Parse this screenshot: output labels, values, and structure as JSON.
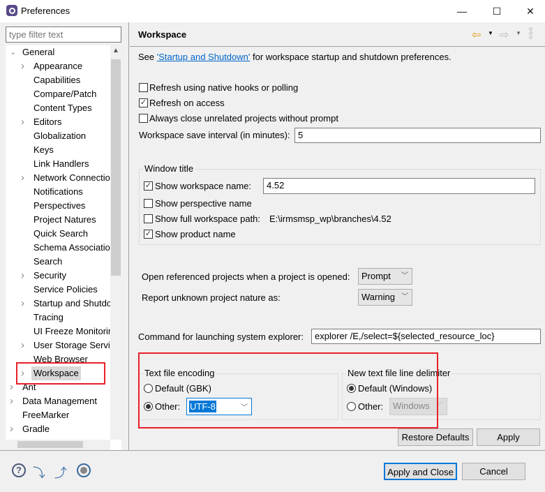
{
  "window": {
    "title": "Preferences",
    "minimize": "—",
    "maximize": "☐",
    "close": "✕"
  },
  "filter": {
    "placeholder": "type filter text"
  },
  "tree": {
    "items": [
      {
        "label": "General",
        "level": 0,
        "arrow": "down"
      },
      {
        "label": "Appearance",
        "level": 1,
        "arrow": "right"
      },
      {
        "label": "Capabilities",
        "level": 1
      },
      {
        "label": "Compare/Patch",
        "level": 1
      },
      {
        "label": "Content Types",
        "level": 1
      },
      {
        "label": "Editors",
        "level": 1,
        "arrow": "right"
      },
      {
        "label": "Globalization",
        "level": 1
      },
      {
        "label": "Keys",
        "level": 1
      },
      {
        "label": "Link Handlers",
        "level": 1
      },
      {
        "label": "Network Connectio",
        "level": 1,
        "arrow": "right"
      },
      {
        "label": "Notifications",
        "level": 1
      },
      {
        "label": "Perspectives",
        "level": 1
      },
      {
        "label": "Project Natures",
        "level": 1
      },
      {
        "label": "Quick Search",
        "level": 1
      },
      {
        "label": "Schema Associatio",
        "level": 1
      },
      {
        "label": "Search",
        "level": 1
      },
      {
        "label": "Security",
        "level": 1,
        "arrow": "right"
      },
      {
        "label": "Service Policies",
        "level": 1
      },
      {
        "label": "Startup and Shutdo",
        "level": 1,
        "arrow": "right"
      },
      {
        "label": "Tracing",
        "level": 1
      },
      {
        "label": "UI Freeze Monitorin",
        "level": 1
      },
      {
        "label": "User Storage Servic",
        "level": 1,
        "arrow": "right"
      },
      {
        "label": "Web Browser",
        "level": 1
      },
      {
        "label": "Workspace",
        "level": 1,
        "arrow": "right",
        "selected": true
      },
      {
        "label": "Ant",
        "level": 0,
        "arrow": "right"
      },
      {
        "label": "Data Management",
        "level": 0,
        "arrow": "right"
      },
      {
        "label": "FreeMarker",
        "level": 0
      },
      {
        "label": "Gradle",
        "level": 0,
        "arrow": "right"
      }
    ]
  },
  "page": {
    "title": "Workspace",
    "see_prefix": "See ",
    "see_link": "'Startup and Shutdown'",
    "see_suffix": " for workspace startup and shutdown preferences.",
    "refresh_native": {
      "label": "Refresh using native hooks or polling",
      "checked": false
    },
    "refresh_access": {
      "label": "Refresh on access",
      "checked": true
    },
    "always_close": {
      "label": "Always close unrelated projects without prompt",
      "checked": false
    },
    "save_interval": {
      "label": "Workspace save interval (in minutes):",
      "value": "5"
    },
    "window_title": {
      "label": "Window title",
      "show_ws_name": {
        "label": "Show workspace name:",
        "checked": true,
        "value": "4.52"
      },
      "show_perspective": {
        "label": "Show perspective name",
        "checked": false
      },
      "show_full_path": {
        "label": "Show full workspace path:",
        "checked": false,
        "value": "E:\\irmsmsp_wp\\branches\\4.52"
      },
      "show_product": {
        "label": "Show product name",
        "checked": true
      }
    },
    "open_ref": {
      "label": "Open referenced projects when a project is opened:",
      "value": "Prompt"
    },
    "report_nature": {
      "label": "Report unknown project nature as:",
      "value": "Warning"
    },
    "explorer": {
      "label": "Command for launching system explorer:",
      "value": "explorer /E,/select=${selected_resource_loc}"
    },
    "encoding": {
      "label": "Text file encoding",
      "default": "Default (GBK)",
      "other": "Other:",
      "value": "UTF-8",
      "selected": "other"
    },
    "delimiter": {
      "label": "New text file line delimiter",
      "default": "Default (Windows)",
      "other": "Other:",
      "value": "Windows",
      "selected": "default"
    },
    "restore": "Restore Defaults",
    "apply": "Apply"
  },
  "footer": {
    "apply_close": "Apply and Close",
    "cancel": "Cancel"
  },
  "colors": {
    "highlight": "#e8202a",
    "link": "#0066cc",
    "selection": "#0078d7"
  }
}
